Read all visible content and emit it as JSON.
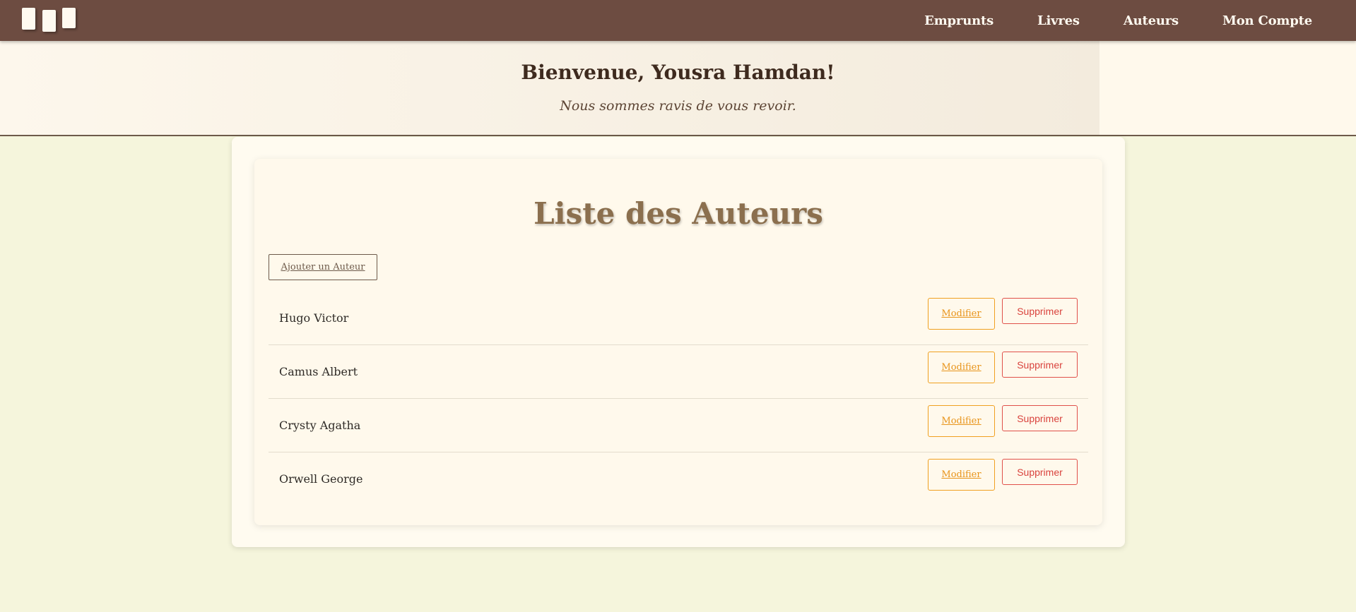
{
  "navbar": {
    "logo": "books-logo",
    "links": [
      "Emprunts",
      "Livres",
      "Auteurs",
      "Mon Compte"
    ]
  },
  "banner": {
    "title": "Bienvenue, Yousra Hamdan!",
    "subtitle": "Nous sommes ravis de vous revoir."
  },
  "main": {
    "title": "Liste des Auteurs",
    "add_label": "Ajouter un Auteur",
    "modify_label": "Modifier",
    "delete_label": "Supprimer",
    "authors": [
      "Hugo Victor",
      "Camus Albert",
      "Crysty Agatha",
      "Orwell George"
    ]
  },
  "colors": {
    "navbar": "#6d4c41",
    "background": "#f5f5dc",
    "title": "#8b6f4e",
    "modify": "#f0a020",
    "delete": "#e0504a"
  }
}
